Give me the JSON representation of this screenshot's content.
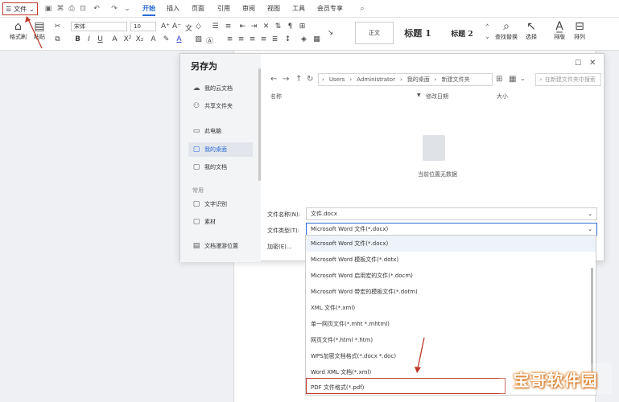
{
  "menubar": {
    "file_label": "文件",
    "tabs": [
      "开始",
      "插入",
      "页面",
      "引用",
      "审阅",
      "视图",
      "工具",
      "会员专享"
    ]
  },
  "ribbon": {
    "format_painter": "格式刷",
    "paste": "粘贴",
    "font_name": "宋体",
    "font_size": "10",
    "styles": [
      "正文",
      "标题 1",
      "标题 2"
    ],
    "find_replace": "查找替换",
    "select": "选择",
    "layout": "排版",
    "sort": "排列"
  },
  "dialog": {
    "title": "另存为",
    "nav_items": [
      "我的云文档",
      "共享文件夹",
      "此电脑",
      "我的桌面",
      "我的文档"
    ],
    "section_label": "常用",
    "common_items": [
      "文字识别",
      "素材",
      "文档漫游位置"
    ],
    "breadcrumb": [
      "Users",
      "Administrator",
      "我的桌面",
      "新建文件夹"
    ],
    "search_placeholder": "在新建文件夹中搜索",
    "columns": {
      "name": "名称",
      "modified": "修改日期",
      "size": "大小"
    },
    "empty_text": "当前位置无数据",
    "filename_label": "文件名称(N):",
    "filename_value": "文件.docx",
    "filetype_label": "文件类型(T):",
    "filetype_value": "Microsoft Word 文件(*.docx)",
    "encrypt_label": "加密(E)..."
  },
  "filetype_options": [
    "Microsoft Word 文件(*.docx)",
    "Microsoft Word 模板文件(*.dotx)",
    "Microsoft Word 启用宏的文件(*.docm)",
    "Microsoft Word 带宏的模板文件(*.dotm)",
    "XML 文件(*.xml)",
    "单一网页文件(*.mht *.mhtml)",
    "网页文件(*.html *.htm)",
    "WPS加密文档格式(*.docx *.doc)",
    "Word XML 文档(*.xml)",
    "PDF 文件格式(*.pdf)"
  ],
  "watermark": "宝哥软件园",
  "colors": {
    "accent": "#2b6bd6",
    "highlight": "#c0392b"
  }
}
